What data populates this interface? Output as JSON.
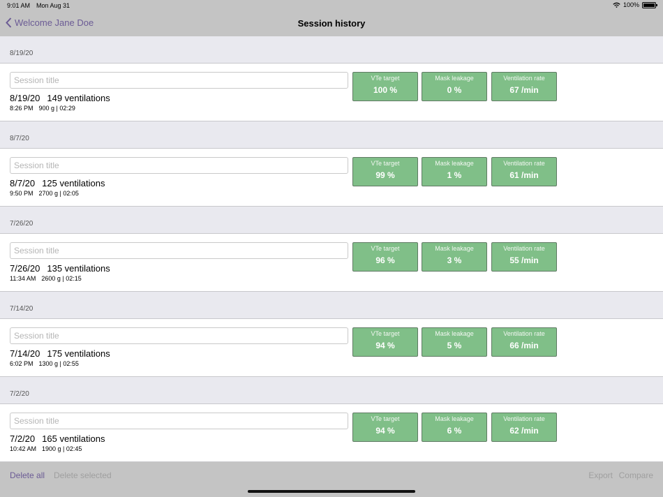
{
  "status_bar": {
    "time": "9:01 AM",
    "date": "Mon Aug 31",
    "battery": "100%"
  },
  "nav": {
    "back_label": "Welcome Jane Doe",
    "title": "Session history"
  },
  "sessions": [
    {
      "header": "8/19/20",
      "placeholder": "Session title",
      "date": "8/19/20",
      "ventilations": "149 ventilations",
      "time": "8:26 PM",
      "meta": "900 g | 02:29",
      "metrics": [
        {
          "label": "VTe target",
          "value": "100 %"
        },
        {
          "label": "Mask leakage",
          "value": "0 %"
        },
        {
          "label": "Ventilation rate",
          "value": "67 /min"
        }
      ]
    },
    {
      "header": "8/7/20",
      "placeholder": "Session title",
      "date": "8/7/20",
      "ventilations": "125 ventilations",
      "time": "9:50 PM",
      "meta": "2700 g | 02:05",
      "metrics": [
        {
          "label": "VTe target",
          "value": "99 %"
        },
        {
          "label": "Mask leakage",
          "value": "1 %"
        },
        {
          "label": "Ventilation rate",
          "value": "61 /min"
        }
      ]
    },
    {
      "header": "7/26/20",
      "placeholder": "Session title",
      "date": "7/26/20",
      "ventilations": "135 ventilations",
      "time": "11:34 AM",
      "meta": "2600 g | 02:15",
      "metrics": [
        {
          "label": "VTe target",
          "value": "96 %"
        },
        {
          "label": "Mask leakage",
          "value": "3 %"
        },
        {
          "label": "Ventilation rate",
          "value": "55 /min"
        }
      ]
    },
    {
      "header": "7/14/20",
      "placeholder": "Session title",
      "date": "7/14/20",
      "ventilations": "175 ventilations",
      "time": "6:02 PM",
      "meta": "1300 g | 02:55",
      "metrics": [
        {
          "label": "VTe target",
          "value": "94 %"
        },
        {
          "label": "Mask leakage",
          "value": "5 %"
        },
        {
          "label": "Ventilation rate",
          "value": "66 /min"
        }
      ]
    },
    {
      "header": "7/2/20",
      "placeholder": "Session title",
      "date": "7/2/20",
      "ventilations": "165 ventilations",
      "time": "10:42 AM",
      "meta": "1900 g | 02:45",
      "metrics": [
        {
          "label": "VTe target",
          "value": "94 %"
        },
        {
          "label": "Mask leakage",
          "value": "6 %"
        },
        {
          "label": "Ventilation rate",
          "value": "62 /min"
        }
      ]
    }
  ],
  "toolbar": {
    "delete_all": "Delete all",
    "delete_selected": "Delete selected",
    "export": "Export",
    "compare": "Compare"
  },
  "colors": {
    "accent": "#6b5b95",
    "metric_green": "#80bf88",
    "bar_gray": "#c4c4c4"
  }
}
